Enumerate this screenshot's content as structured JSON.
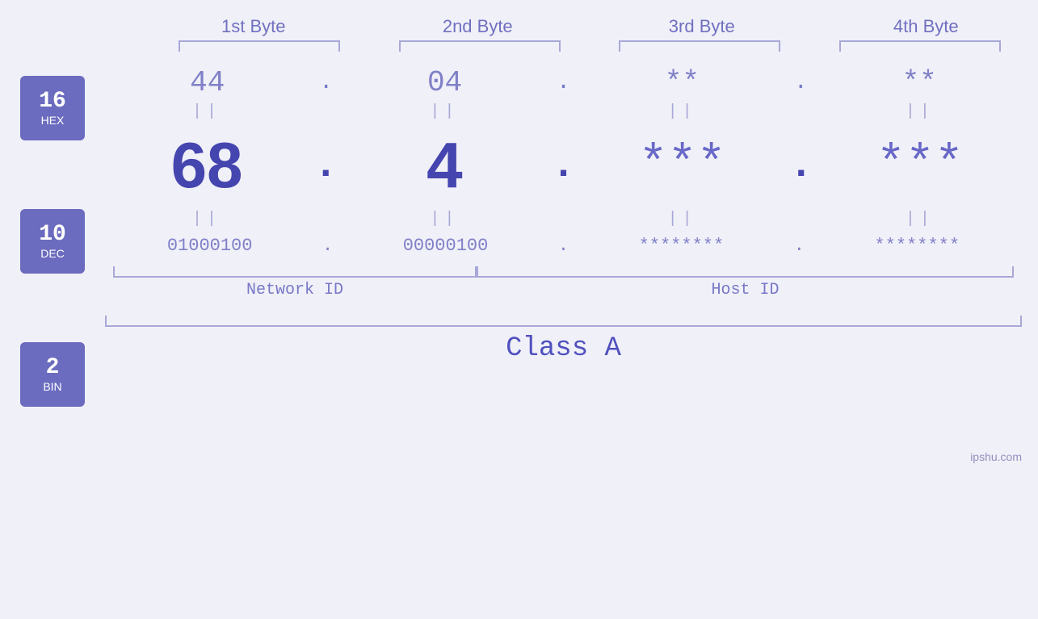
{
  "page": {
    "background": "#f0f0f8",
    "watermark": "ipshu.com"
  },
  "headers": {
    "byte1": "1st Byte",
    "byte2": "2nd Byte",
    "byte3": "3rd Byte",
    "byte4": "4th Byte"
  },
  "badges": [
    {
      "id": "hex-badge",
      "number": "16",
      "label": "HEX"
    },
    {
      "id": "dec-badge",
      "number": "10",
      "label": "DEC"
    },
    {
      "id": "bin-badge",
      "number": "2",
      "label": "BIN"
    }
  ],
  "hex_row": {
    "b1": "44",
    "b2": "04",
    "b3": "**",
    "b4": "**",
    "dots": [
      ".",
      ".",
      ".",
      "."
    ]
  },
  "dec_row": {
    "b1": "68",
    "b2": "4",
    "b3": "***",
    "b4": "***",
    "dots": [
      ".",
      ".",
      ".",
      "."
    ]
  },
  "bin_row": {
    "b1": "01000100",
    "b2": "00000100",
    "b3": "********",
    "b4": "********",
    "dots": [
      ".",
      ".",
      ".",
      "."
    ]
  },
  "labels": {
    "network_id": "Network ID",
    "host_id": "Host ID",
    "class": "Class A"
  },
  "equals": "||"
}
